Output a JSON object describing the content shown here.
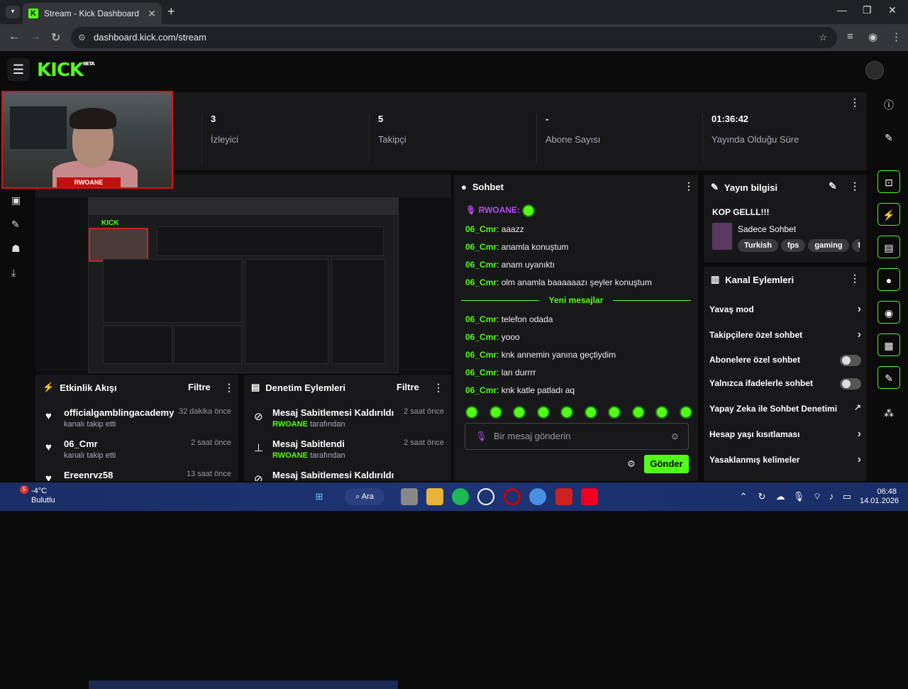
{
  "browser": {
    "tab_title": "Stream - Kick Dashboard",
    "url": "dashboard.kick.com/stream"
  },
  "header": {
    "logo": "KICK",
    "logo_badge": "BETA"
  },
  "webcam": {
    "name_tag": "RWOANE"
  },
  "stats": [
    {
      "value": "3",
      "label": "İzleyici"
    },
    {
      "value": "5",
      "label": "Takipçi"
    },
    {
      "value": "-",
      "label": "Abone Sayısı"
    },
    {
      "value": "01:36:42",
      "label": "Yayında Olduğu Süre"
    }
  ],
  "activity": {
    "title": "Etkinlik Akışı",
    "filter": "Filtre",
    "items": [
      {
        "name": "officialgamblingacademy",
        "sub": "kanalı takip etti",
        "time": "32 dakika önce"
      },
      {
        "name": "06_Cmr",
        "sub": "kanalı takip etti",
        "time": "2 saat önce"
      },
      {
        "name": "Ereenrvz58",
        "sub": "",
        "time": "13 saat önce"
      }
    ]
  },
  "moderation": {
    "title": "Denetim Eylemleri",
    "filter": "Filtre",
    "by": "tarafından",
    "items": [
      {
        "action": "Mesaj Sabitlemesi Kaldırıldı",
        "user": "RWOANE",
        "time": "2 saat önce"
      },
      {
        "action": "Mesaj Sabitlendi",
        "user": "RWOANE",
        "time": "2 saat önce"
      },
      {
        "action": "Mesaj Sabitlemesi Kaldırıldı",
        "user": "",
        "time": ""
      }
    ]
  },
  "chat": {
    "title": "Sohbet",
    "pinned_user": "RWOANE:",
    "new_messages": "Yeni mesajlar",
    "placeholder": "Bir mesaj gönderin",
    "send": "Gönder",
    "before": [
      {
        "user": "06_Cmr",
        "text": ": aaazz"
      },
      {
        "user": "06_Cmr",
        "text": ": anamla konuştum"
      },
      {
        "user": "06_Cmr",
        "text": ": anam uyanıktı"
      },
      {
        "user": "06_Cmr",
        "text": ": olm anamla baaaaaazı şeyler konuştum"
      }
    ],
    "after": [
      {
        "user": "06_Cmr",
        "text": ": telefon odada"
      },
      {
        "user": "06_Cmr",
        "text": ": yooo"
      },
      {
        "user": "06_Cmr",
        "text": ": knk annemin yanına geçtiydim"
      },
      {
        "user": "06_Cmr",
        "text": ": lan durrrr"
      },
      {
        "user": "06_Cmr",
        "text": ": knk katle patladı aq"
      }
    ]
  },
  "stream_info": {
    "title": "Yayın bilgisi",
    "stream_title": "KOP GELLL!!!",
    "category": "Sadece Sohbet",
    "tags": [
      "Turkish",
      "fps",
      "gaming",
      "funny"
    ]
  },
  "channel_actions": {
    "title": "Kanal Eylemleri",
    "items": [
      {
        "label": "Yavaş mod",
        "kind": "chev"
      },
      {
        "label": "Takipçilere özel sohbet",
        "kind": "chev"
      },
      {
        "label": "Abonelere özel sohbet",
        "kind": "toggle"
      },
      {
        "label": "Yalnızca ifadelerle sohbet",
        "kind": "toggle"
      },
      {
        "label": "Yapay Zeka ile Sohbet Denetimi",
        "kind": "ext"
      },
      {
        "label": "Hesap yaşı kısıtlaması",
        "kind": "chev"
      },
      {
        "label": "Yasaklanmış kelimeler",
        "kind": "chev"
      }
    ]
  },
  "taskbar": {
    "temp": "-4°C",
    "weather": "Bulutlu",
    "search": "Ara",
    "time": "06:48",
    "date": "14.01.2026",
    "badge": "5"
  }
}
